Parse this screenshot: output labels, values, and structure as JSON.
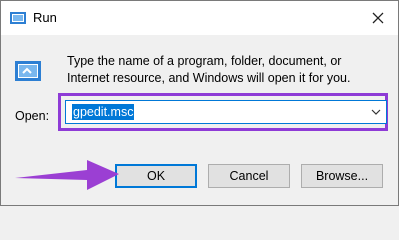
{
  "window": {
    "title": "Run",
    "description": "Type the name of a program, folder, document, or Internet resource, and Windows will open it for you.",
    "open_label": "Open:",
    "input_value": "gpedit.msc"
  },
  "buttons": {
    "ok": "OK",
    "cancel": "Cancel",
    "browse": "Browse..."
  },
  "colors": {
    "highlight": "#8e3bd6",
    "arrow": "#9b3fd3",
    "selection": "#0078d7"
  }
}
